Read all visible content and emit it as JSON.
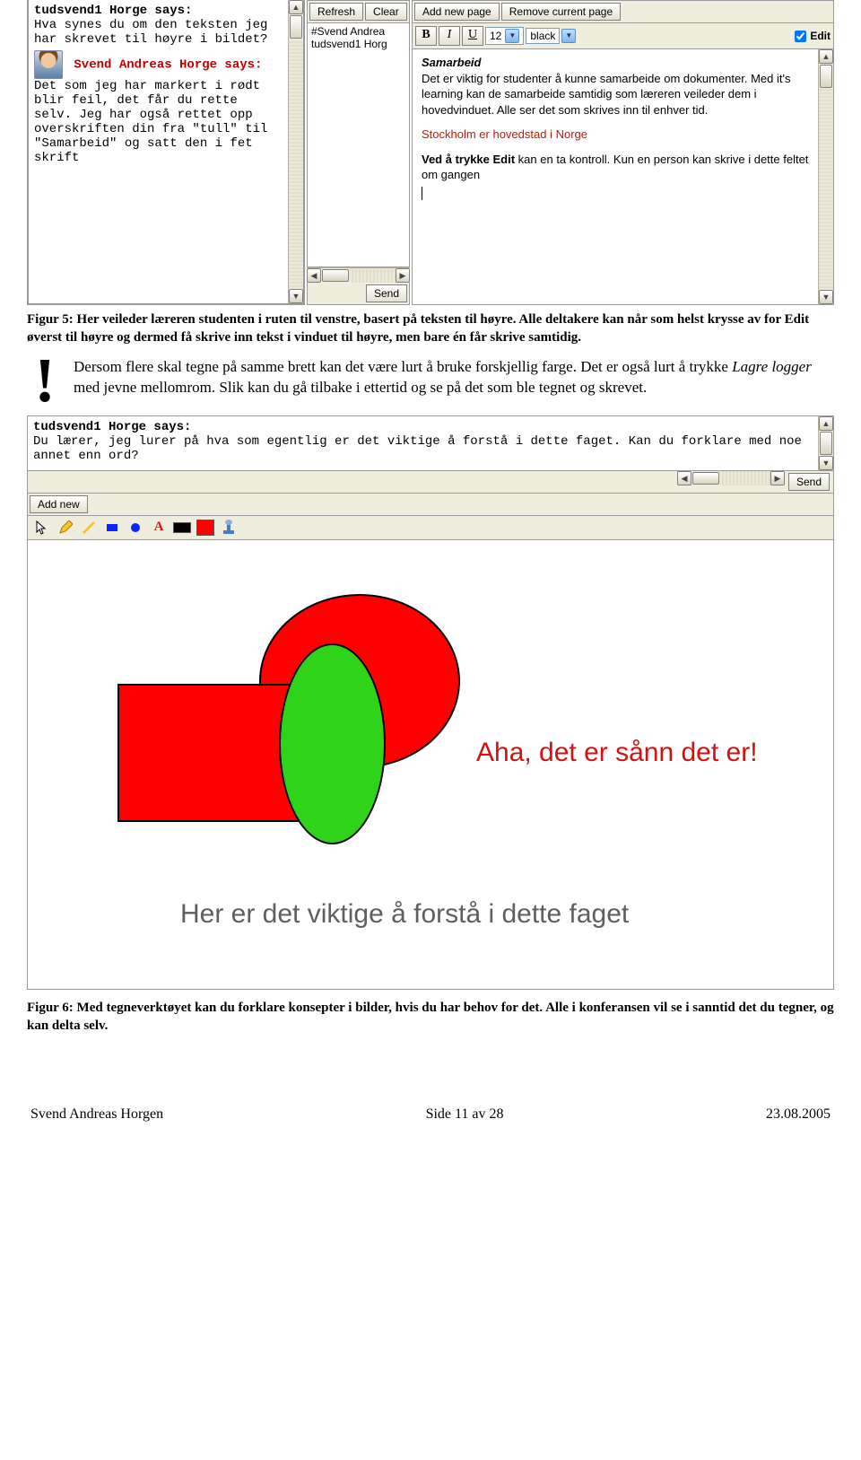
{
  "fig5": {
    "chat": {
      "user1_says": "tudsvend1 Horge says:",
      "user1_msg": "Hva synes du om den teksten jeg har skrevet til høyre i bildet?",
      "user2_says": "Svend Andreas Horge says:",
      "user2_msg": "Det som jeg har markert i rødt blir feil, det får du rette selv. Jeg har også rettet opp overskriften din fra \"tull\" til \"Samarbeid\" og satt den i fet skrift"
    },
    "mid": {
      "refresh": "Refresh",
      "clear": "Clear",
      "row1": "#Svend Andrea",
      "row2": "tudsvend1 Horg",
      "send": "Send"
    },
    "right": {
      "tab_add": "Add new page",
      "tab_remove": "Remove current page",
      "b": "B",
      "i": "I",
      "u": "U",
      "size": "12",
      "color": "black",
      "edit": "Edit",
      "heading": "Samarbeid",
      "para1": "Det er viktig for studenter å kunne samarbeide om dokumenter. Med it's learning kan de samarbeide samtidig som læreren veileder dem i hovedvinduet. Alle ser det som skrives inn til enhver tid.",
      "red": "Stockholm er hovedstad i Norge",
      "para2a": "Ved å trykke Edit",
      "para2b": " kan en ta kontroll. Kun en person kan skrive i dette feltet om gangen"
    }
  },
  "caption5": "Figur 5: Her veileder læreren studenten i ruten til venstre, basert på teksten til høyre. Alle deltakere kan når som helst krysse av for Edit øverst til høyre og dermed få skrive inn tekst i vinduet til høyre, men bare én får skrive samtidig.",
  "note": {
    "bang": "!",
    "text_a": "Dersom flere skal tegne på samme brett kan det være lurt å bruke forskjellig farge. Det er også lurt å trykke ",
    "text_ital": "Lagre logger",
    "text_b": " med jevne mellomrom. Slik kan du gå tilbake i ettertid og se på det som ble tegnet og skrevet."
  },
  "fig6": {
    "chat_says": "tudsvend1 Horge says:",
    "chat_msg": "Du lærer, jeg lurer på hva som egentlig er det viktige å forstå i dette faget. Kan du forklare med noe annet enn ord?",
    "send": "Send",
    "addnew": "Add new",
    "aha": "Aha, det er sånn det er!",
    "gray": "Her er det viktige å forstå i dette faget"
  },
  "caption6": "Figur 6: Med tegneverktøyet kan du forklare konsepter i bilder, hvis du har behov for det. Alle i konferansen vil se i sanntid det du tegner, og kan delta selv.",
  "footer": {
    "author": "Svend Andreas Horgen",
    "page": "Side 11 av 28",
    "date": "23.08.2005"
  },
  "toolbar_icons": {
    "A": "A"
  }
}
